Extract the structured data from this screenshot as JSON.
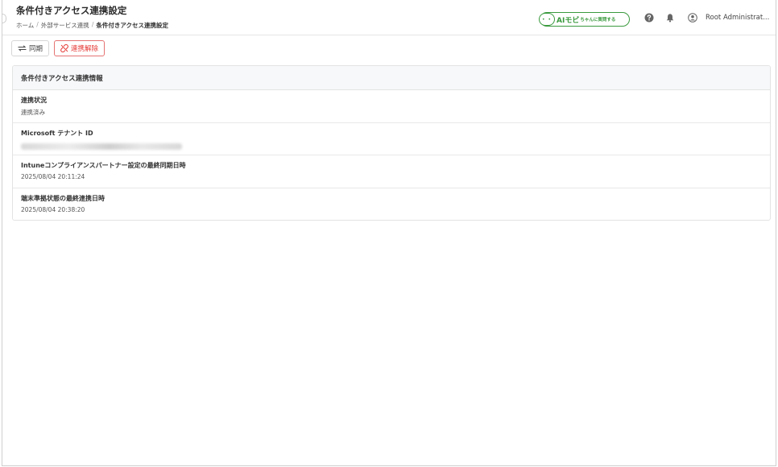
{
  "header": {
    "title": "条件付きアクセス連携設定",
    "breadcrumb": {
      "items": [
        "ホーム",
        "外部サービス連携",
        "条件付きアクセス連携設定"
      ],
      "separator": "/"
    },
    "ai_button": {
      "face": "• •",
      "label": "AIモビ",
      "sub": "ちゃんに質問する"
    },
    "user_name": "Root Administrat..."
  },
  "toolbar": {
    "sync_label": "同期",
    "unlink_label": "連携解除"
  },
  "card": {
    "title": "条件付きアクセス連携情報",
    "rows": [
      {
        "label": "連携状況",
        "value": "連携済み"
      },
      {
        "label": "Microsoft テナント ID",
        "value": ""
      },
      {
        "label": "Intuneコンプライアンスパートナー設定の最終同期日時",
        "value": "2025/08/04 20:11:24"
      },
      {
        "label": "端末準拠状態の最終連携日時",
        "value": "2025/08/04 20:38:20"
      }
    ]
  },
  "colors": {
    "ai_green": "#3a9a3e",
    "danger_red": "#e53935",
    "card_header_bg": "#f7f8fa"
  },
  "icons": [
    "sync-icon",
    "unlink-icon",
    "help-icon",
    "bell-icon",
    "user-icon"
  ]
}
